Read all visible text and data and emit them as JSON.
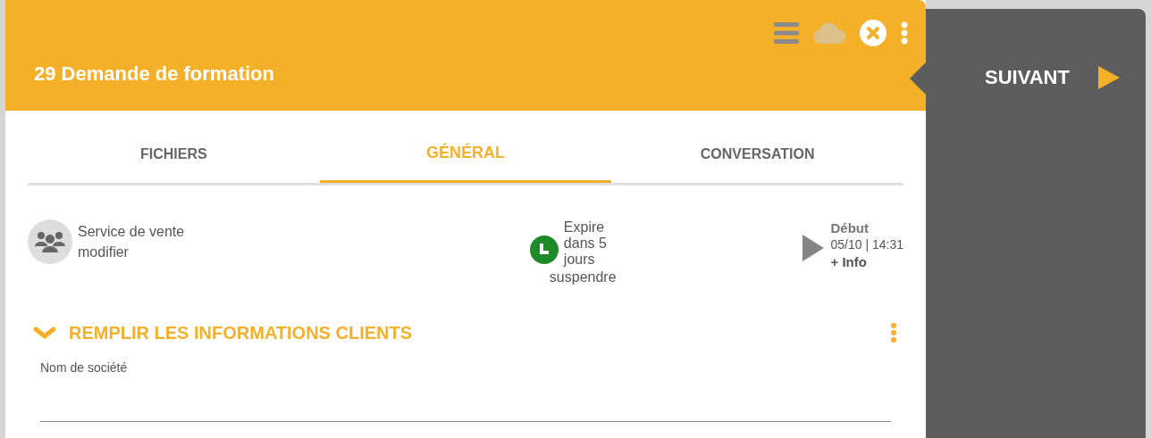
{
  "header": {
    "title": "29 Demande de formation"
  },
  "next_button": {
    "label": "SUIVANT"
  },
  "tabs": [
    {
      "label": "FICHIERS",
      "selected": false
    },
    {
      "label": "GÉNÉRAL",
      "selected": true
    },
    {
      "label": "CONVERSATION",
      "selected": false
    }
  ],
  "info": {
    "group": {
      "name": "Service de vente",
      "action": "modifier"
    },
    "deadline": {
      "text": "Expire dans 5 jours",
      "action": "suspendre"
    },
    "start": {
      "label": "Début",
      "datetime": "05/10 | 14:31",
      "link": "+ Info"
    }
  },
  "section": {
    "title": "REMPLIR LES INFORMATIONS CLIENTS",
    "expanded": true,
    "fields": [
      {
        "label": "Nom de société"
      }
    ]
  }
}
